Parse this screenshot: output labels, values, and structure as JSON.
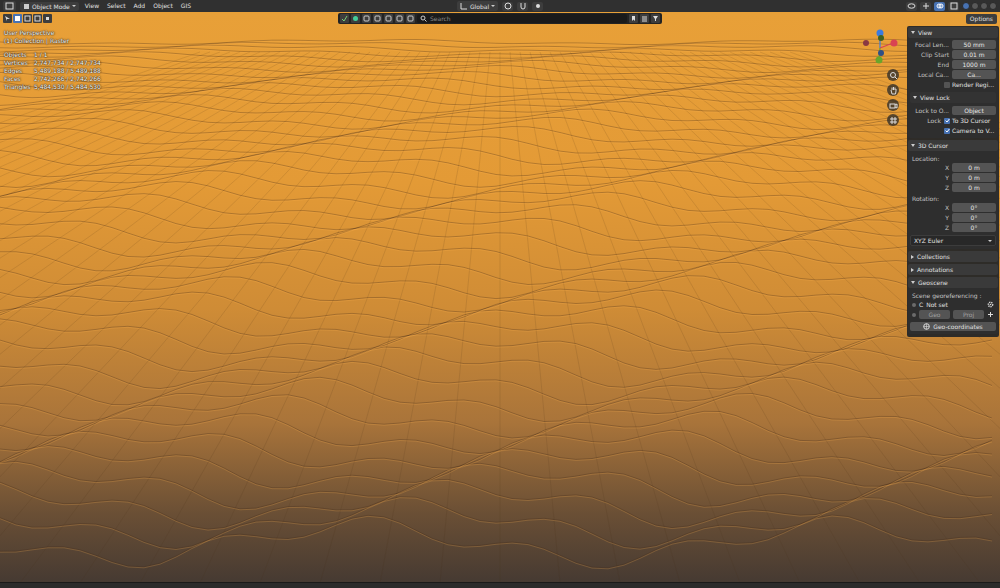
{
  "header": {
    "mode": "Object Mode",
    "menus": [
      "View",
      "Select",
      "Add",
      "Object",
      "GIS"
    ],
    "orientation": "Global"
  },
  "toolbar": {
    "search": {
      "placeholder": "Search"
    },
    "options": "Options"
  },
  "viewport": {
    "view_name": "User Perspective",
    "collection": "(1) Collection | Raster",
    "stats": [
      {
        "label": "Objects",
        "value": "1 / 1"
      },
      {
        "label": "Vertices",
        "value": "2,747,734 / 2,747,734"
      },
      {
        "label": "Edges",
        "value": "5,489,188 / 5,489,188"
      },
      {
        "label": "Faces",
        "value": "2,742,266 / 2,742,266"
      },
      {
        "label": "Triangles",
        "value": "5,484,530 / 5,484,530"
      }
    ]
  },
  "sidebar": {
    "panels": [
      {
        "title": "View",
        "expanded": true,
        "rows": [
          {
            "kind": "field",
            "label": "Focal Len...",
            "value": "50 mm"
          },
          {
            "kind": "field",
            "label": "Clip Start",
            "value": "0.01 m"
          },
          {
            "kind": "field",
            "label": "End",
            "value": "1000 m"
          },
          {
            "kind": "field",
            "label": "Local Ca...",
            "value": "Ca..."
          },
          {
            "kind": "checkbox",
            "label": "Render Regi...",
            "checked": false
          },
          {
            "kind": "subheader",
            "label": "View Lock"
          },
          {
            "kind": "field",
            "label": "Lock to O...",
            "value": "Object"
          },
          {
            "kind": "checkbox",
            "lead": "Lock",
            "label": "To 3D Cursor",
            "checked": true
          },
          {
            "kind": "checkbox",
            "label": "Camera to V...",
            "checked": true
          }
        ]
      },
      {
        "title": "3D Cursor",
        "expanded": true,
        "rows": [
          {
            "kind": "caption",
            "label": "Location:"
          },
          {
            "kind": "field",
            "label": "X",
            "value": "0 m"
          },
          {
            "kind": "field",
            "label": "Y",
            "value": "0 m"
          },
          {
            "kind": "field",
            "label": "Z",
            "value": "0 m"
          },
          {
            "kind": "caption",
            "label": "Rotation:"
          },
          {
            "kind": "field",
            "label": "X",
            "value": "0°"
          },
          {
            "kind": "field",
            "label": "Y",
            "value": "0°"
          },
          {
            "kind": "field",
            "label": "Z",
            "value": "0°"
          },
          {
            "kind": "dropdown",
            "value": "XYZ Euler"
          }
        ]
      },
      {
        "title": "Collections",
        "expanded": false,
        "rows": []
      },
      {
        "title": "Annotations",
        "expanded": false,
        "rows": []
      },
      {
        "title": "Geoscene",
        "expanded": true,
        "rows": [
          {
            "kind": "caption",
            "label": "Scene georeferencing :"
          },
          {
            "kind": "status",
            "badge": "C",
            "value": "Not set"
          },
          {
            "kind": "buttons",
            "items": [
              "Geo",
              "Proj"
            ]
          },
          {
            "kind": "button",
            "label": "Geo-coordinates"
          }
        ]
      }
    ]
  }
}
